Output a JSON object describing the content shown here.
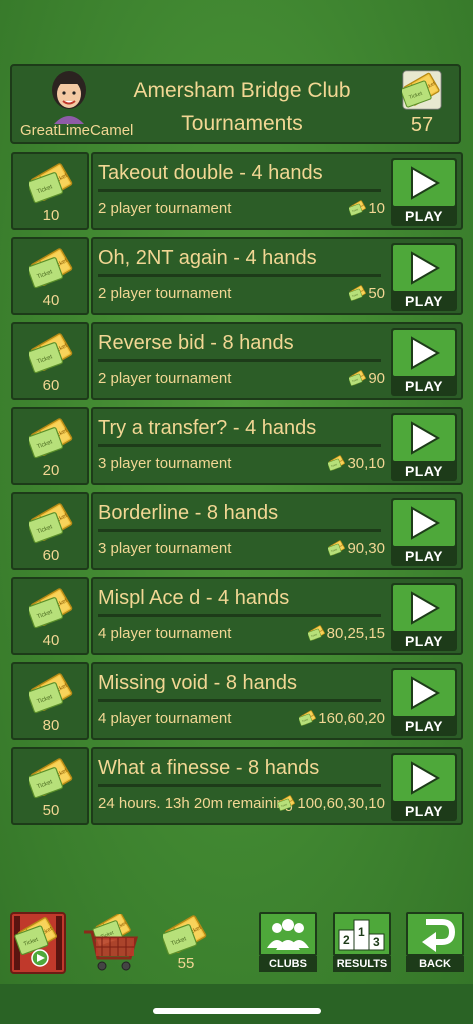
{
  "header": {
    "username": "GreatLimeCamel",
    "title_line1": "Amersham Bridge Club",
    "title_line2": "Tournaments",
    "ticket_count": "57"
  },
  "tournaments": [
    {
      "cost": "10",
      "name": "Takeout double - 4 hands",
      "sub": "2 player tournament",
      "prize": "10",
      "play": "PLAY"
    },
    {
      "cost": "40",
      "name": "Oh, 2NT again - 4 hands",
      "sub": "2 player tournament",
      "prize": "50",
      "play": "PLAY"
    },
    {
      "cost": "60",
      "name": "Reverse bid - 8 hands",
      "sub": "2 player tournament",
      "prize": "90",
      "play": "PLAY"
    },
    {
      "cost": "20",
      "name": "Try a transfer? - 4 hands",
      "sub": "3 player tournament",
      "prize": "30,10",
      "play": "PLAY"
    },
    {
      "cost": "60",
      "name": "Borderline - 8 hands",
      "sub": "3 player tournament",
      "prize": "90,30",
      "play": "PLAY"
    },
    {
      "cost": "40",
      "name": "Mispl Ace d - 4 hands",
      "sub": "4 player tournament",
      "prize": "80,25,15",
      "play": "PLAY"
    },
    {
      "cost": "80",
      "name": "Missing void - 8 hands",
      "sub": "4 player tournament",
      "prize": "160,60,20",
      "play": "PLAY"
    },
    {
      "cost": "50",
      "name": "What a finesse - 8 hands",
      "sub": "24 hours.  13h 20m remaining",
      "prize": "100,60,30,10",
      "play": "PLAY"
    }
  ],
  "bottom": {
    "tickets_count": "55",
    "clubs_label": "CLUBS",
    "results_label": "RESULTS",
    "back_label": "BACK"
  },
  "colors": {
    "background": "#3f8530",
    "panel": "#2c5d27",
    "text": "#f2d794",
    "play_green": "#4ea83a"
  }
}
